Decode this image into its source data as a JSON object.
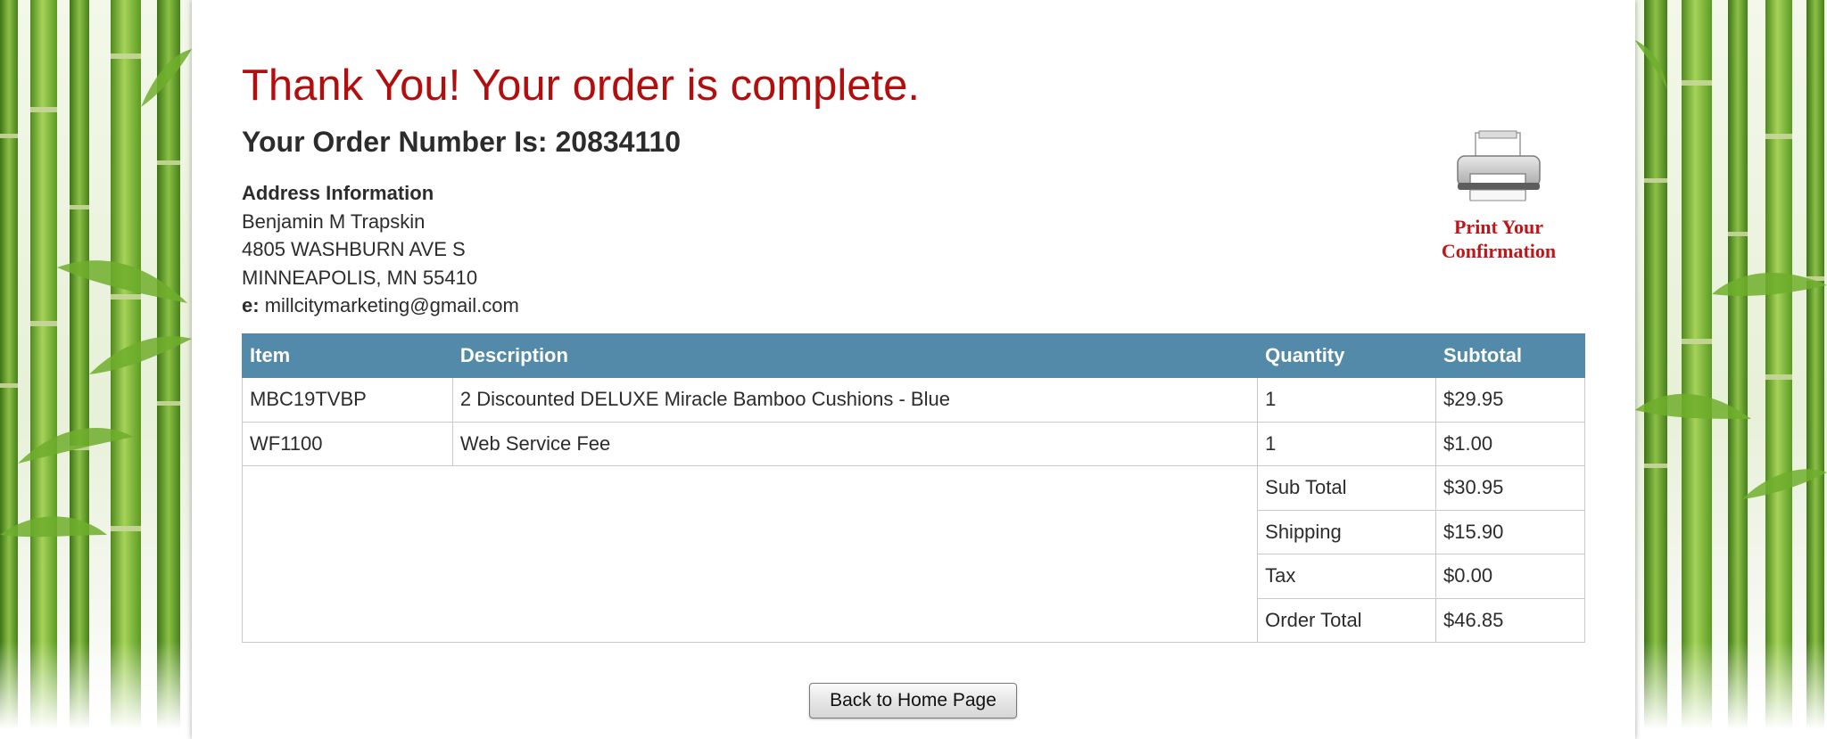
{
  "confirmation": {
    "heading": "Thank You! Your order is complete.",
    "order_number_line": "Your Order Number Is: 20834110"
  },
  "address": {
    "heading": "Address Information",
    "name": "Benjamin M Trapskin",
    "street": "4805 WASHBURN AVE S",
    "city_state_zip": "MINNEAPOLIS, MN 55410",
    "email_label": "e:",
    "email": "millcitymarketing@gmail.com"
  },
  "print": {
    "icon": "printer-icon",
    "line1": "Print Your",
    "line2": "Confirmation"
  },
  "table": {
    "headers": {
      "item": "Item",
      "description": "Description",
      "quantity": "Quantity",
      "subtotal": "Subtotal"
    },
    "rows": [
      {
        "item": "MBC19TVBP",
        "description": "2 Discounted DELUXE Miracle Bamboo Cushions - Blue",
        "quantity": "1",
        "subtotal": "$29.95"
      },
      {
        "item": "WF1100",
        "description": "Web Service Fee",
        "quantity": "1",
        "subtotal": "$1.00"
      }
    ],
    "totals": {
      "sub_total_label": "Sub Total",
      "sub_total_value": "$30.95",
      "shipping_label": "Shipping",
      "shipping_value": "$15.90",
      "tax_label": "Tax",
      "tax_value": "$0.00",
      "order_total_label": "Order Total",
      "order_total_value": "$46.85"
    }
  },
  "actions": {
    "back_label": "Back to Home Page"
  },
  "colors": {
    "heading_red": "#b30e0e",
    "table_header_blue": "#5389a9",
    "bamboo_green": "#7fb43a"
  }
}
